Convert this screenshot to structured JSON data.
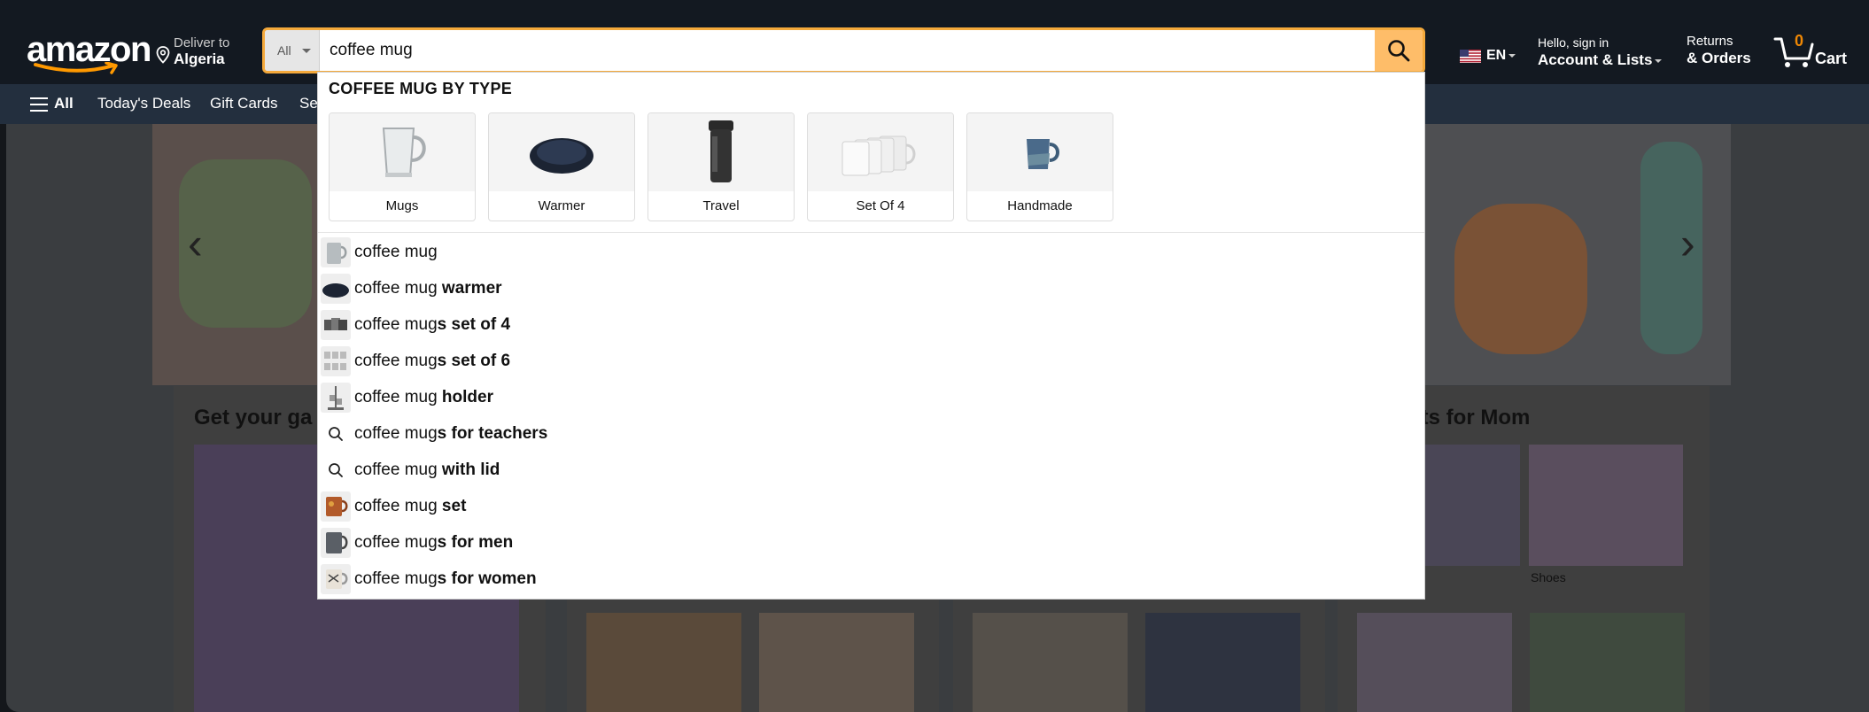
{
  "header": {
    "logo_text": "amazon",
    "deliver_line1": "Deliver to",
    "deliver_line2": "Algeria",
    "search_category": "All",
    "search_value": "coffee mug",
    "language": "EN",
    "account_line1": "Hello, sign in",
    "account_line2": "Account & Lists",
    "returns_line1": "Returns",
    "returns_line2": "& Orders",
    "cart_count": "0",
    "cart_label": "Cart"
  },
  "subnav": {
    "all_label": "All",
    "links": [
      "Today's Deals",
      "Gift Cards",
      "Se"
    ]
  },
  "background_cards": {
    "card1_title": "Get your ga",
    "card4_title": "ifts for Mom",
    "card4_caption": "Shoes"
  },
  "dropdown": {
    "section_title": "COFFEE MUG BY TYPE",
    "types": [
      "Mugs",
      "Warmer",
      "Travel",
      "Set Of 4",
      "Handmade"
    ],
    "suggestions": [
      {
        "prefix": "coffee mug",
        "bold": "",
        "icon": "thumb"
      },
      {
        "prefix": "coffee mug",
        "bold": " warmer",
        "icon": "thumb"
      },
      {
        "prefix": "coffee mug",
        "bold": "s set of 4",
        "icon": "thumb"
      },
      {
        "prefix": "coffee mug",
        "bold": "s set of 6",
        "icon": "thumb"
      },
      {
        "prefix": "coffee mug",
        "bold": " holder",
        "icon": "thumb"
      },
      {
        "prefix": "coffee mug",
        "bold": "s for teachers",
        "icon": "search-icon"
      },
      {
        "prefix": "coffee mug",
        "bold": " with lid",
        "icon": "search-icon"
      },
      {
        "prefix": "coffee mug",
        "bold": " set",
        "icon": "thumb"
      },
      {
        "prefix": "coffee mug",
        "bold": "s for men",
        "icon": "thumb"
      },
      {
        "prefix": "coffee mug",
        "bold": "s for women",
        "icon": "thumb"
      }
    ]
  },
  "colors": {
    "nav_dark": "#131921",
    "nav_sub": "#232f3e",
    "search_button": "#febd69",
    "search_focus": "#f4a93b",
    "cart_count": "#f08804"
  }
}
